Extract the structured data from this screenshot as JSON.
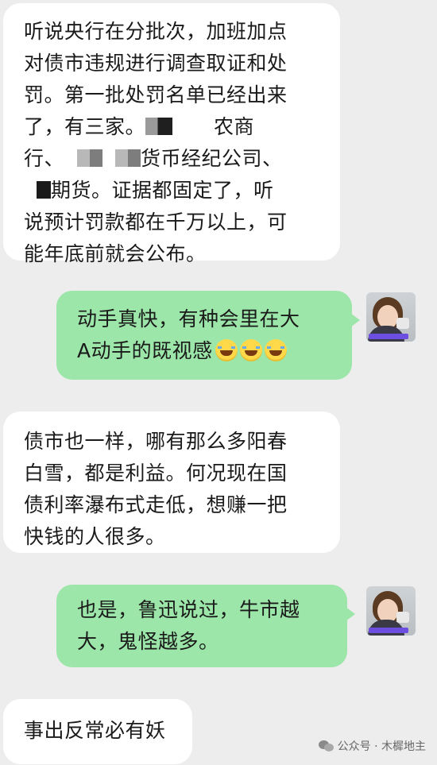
{
  "messages": [
    {
      "side": "left",
      "lines": [
        "听说央行在分批次，加班加点",
        "对债市违规进行调查取证和处",
        "罚。第一批处罚名单已经出来",
        "了，有三家。",
        "农商",
        "行、",
        "货币经纪公司、",
        "期货。证据都固定了，听",
        "说预计罚款都在千万以上，可",
        "能年底前就会公布。"
      ]
    },
    {
      "side": "right",
      "lines": [
        "动手真快，有种会里在大",
        "A动手的既视感"
      ],
      "emoji": "facepalm-laugh-emoji"
    },
    {
      "side": "left",
      "lines": [
        "债市也一样，哪有那么多阳春",
        "白雪，都是利益。何况现在国",
        "债利率瀑布式走低，想赚一把",
        "快钱的人很多。"
      ]
    },
    {
      "side": "right",
      "lines": [
        "也是，鲁迅说过，牛市越",
        "大，鬼怪越多。"
      ]
    },
    {
      "side": "left",
      "lines": [
        "事出反常必有妖"
      ]
    }
  ],
  "watermark": {
    "icon": "wechat-icon",
    "text": "公众号 · 木樨地主"
  },
  "colors": {
    "background": "#ededed",
    "left_bubble": "#ffffff",
    "right_bubble": "#9be6a8",
    "text": "#1a1a1a"
  }
}
